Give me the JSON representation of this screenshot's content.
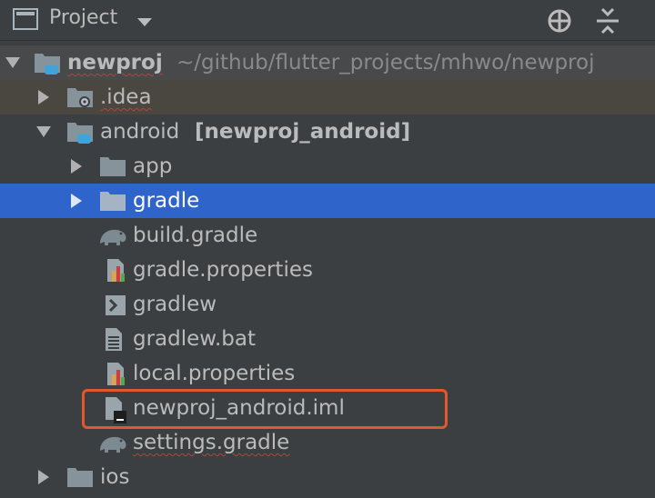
{
  "header": {
    "title": "Project"
  },
  "tree": {
    "root": {
      "name": "newproj",
      "path": "~/github/flutter_projects/mhwo/newproj"
    },
    "idea": ".idea",
    "android": {
      "name": "android",
      "module": "[newproj_android]"
    },
    "app": "app",
    "gradle": "gradle",
    "build_gradle": "build.gradle",
    "gradle_properties": "gradle.properties",
    "gradlew": "gradlew",
    "gradlew_bat": "gradlew.bat",
    "local_properties": "local.properties",
    "iml": "newproj_android.iml",
    "settings_gradle": "settings.gradle",
    "ios": "ios"
  },
  "colors": {
    "background": "#3c3f41",
    "selection": "#2f65ca",
    "highlight_box": "#e4572e",
    "folder": "#87939a",
    "flutter_badge": "#40a3d9"
  }
}
